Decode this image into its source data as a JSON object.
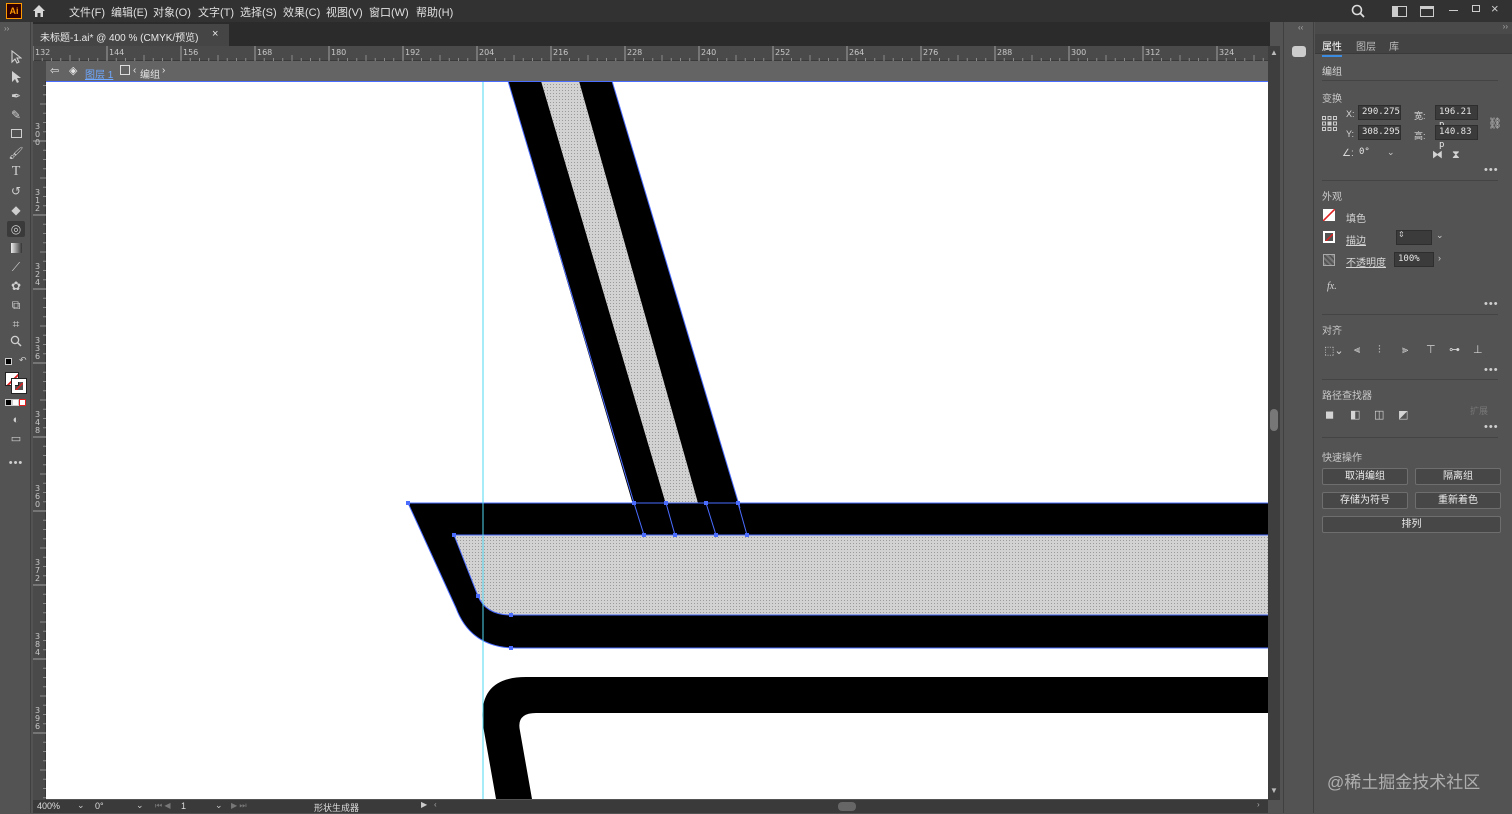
{
  "app": {
    "logo": "Ai"
  },
  "menu": [
    "文件(F)",
    "编辑(E)",
    "对象(O)",
    "文字(T)",
    "选择(S)",
    "效果(C)",
    "视图(V)",
    "窗口(W)",
    "帮助(H)"
  ],
  "document_tab": {
    "title": "未标题-1.ai* @ 400 % (CMYK/预览)",
    "close": "×"
  },
  "ruler_h": [
    "132",
    "144",
    "156",
    "168",
    "180",
    "192",
    "204",
    "216",
    "228",
    "240",
    "252",
    "264",
    "276",
    "288",
    "300",
    "312",
    "324"
  ],
  "ruler_v": [
    "3\n0\n0",
    "3\n1\n2",
    "3\n2\n4",
    "3\n3\n6",
    "3\n4\n8",
    "3\n6\n0",
    "3\n7\n2",
    "3\n8\n4",
    "3\n9\n6",
    "2\n8\n8"
  ],
  "breadcrumb": {
    "layer": "图层 1",
    "group": "编组"
  },
  "status": {
    "zoom": "400%",
    "rotation": "0°",
    "artboard": "1",
    "tool": "形状生成器"
  },
  "panel": {
    "tabs": [
      "属性",
      "图层",
      "库"
    ],
    "selection_type": "编组",
    "transform": {
      "title": "变换",
      "x_label": "X:",
      "x": "290.275",
      "y_label": "Y:",
      "y": "308.295",
      "w_label": "宽:",
      "w": "196.21 p",
      "h_label": "高:",
      "h": "140.83 p",
      "angle": "0°"
    },
    "appearance": {
      "title": "外观",
      "fill": "填色",
      "stroke": "描边",
      "opacity_label": "不透明度",
      "opacity": "100%",
      "fx": "fx."
    },
    "align": {
      "title": "对齐"
    },
    "pathfinder": {
      "title": "路径查找器",
      "expand": "扩展"
    },
    "quick_actions": {
      "title": "快速操作",
      "ungroup": "取消编组",
      "isolate": "隔离组",
      "save_symbol": "存储为符号",
      "recolor": "重新着色",
      "arrange": "排列"
    }
  },
  "watermark": "@稀土掘金技术社区",
  "colors": {
    "app_bg": "#535353",
    "menubar": "#323232",
    "selection": "#4a6cff",
    "guide": "#4ed8f0",
    "accent_tab": "#3b8be0"
  }
}
